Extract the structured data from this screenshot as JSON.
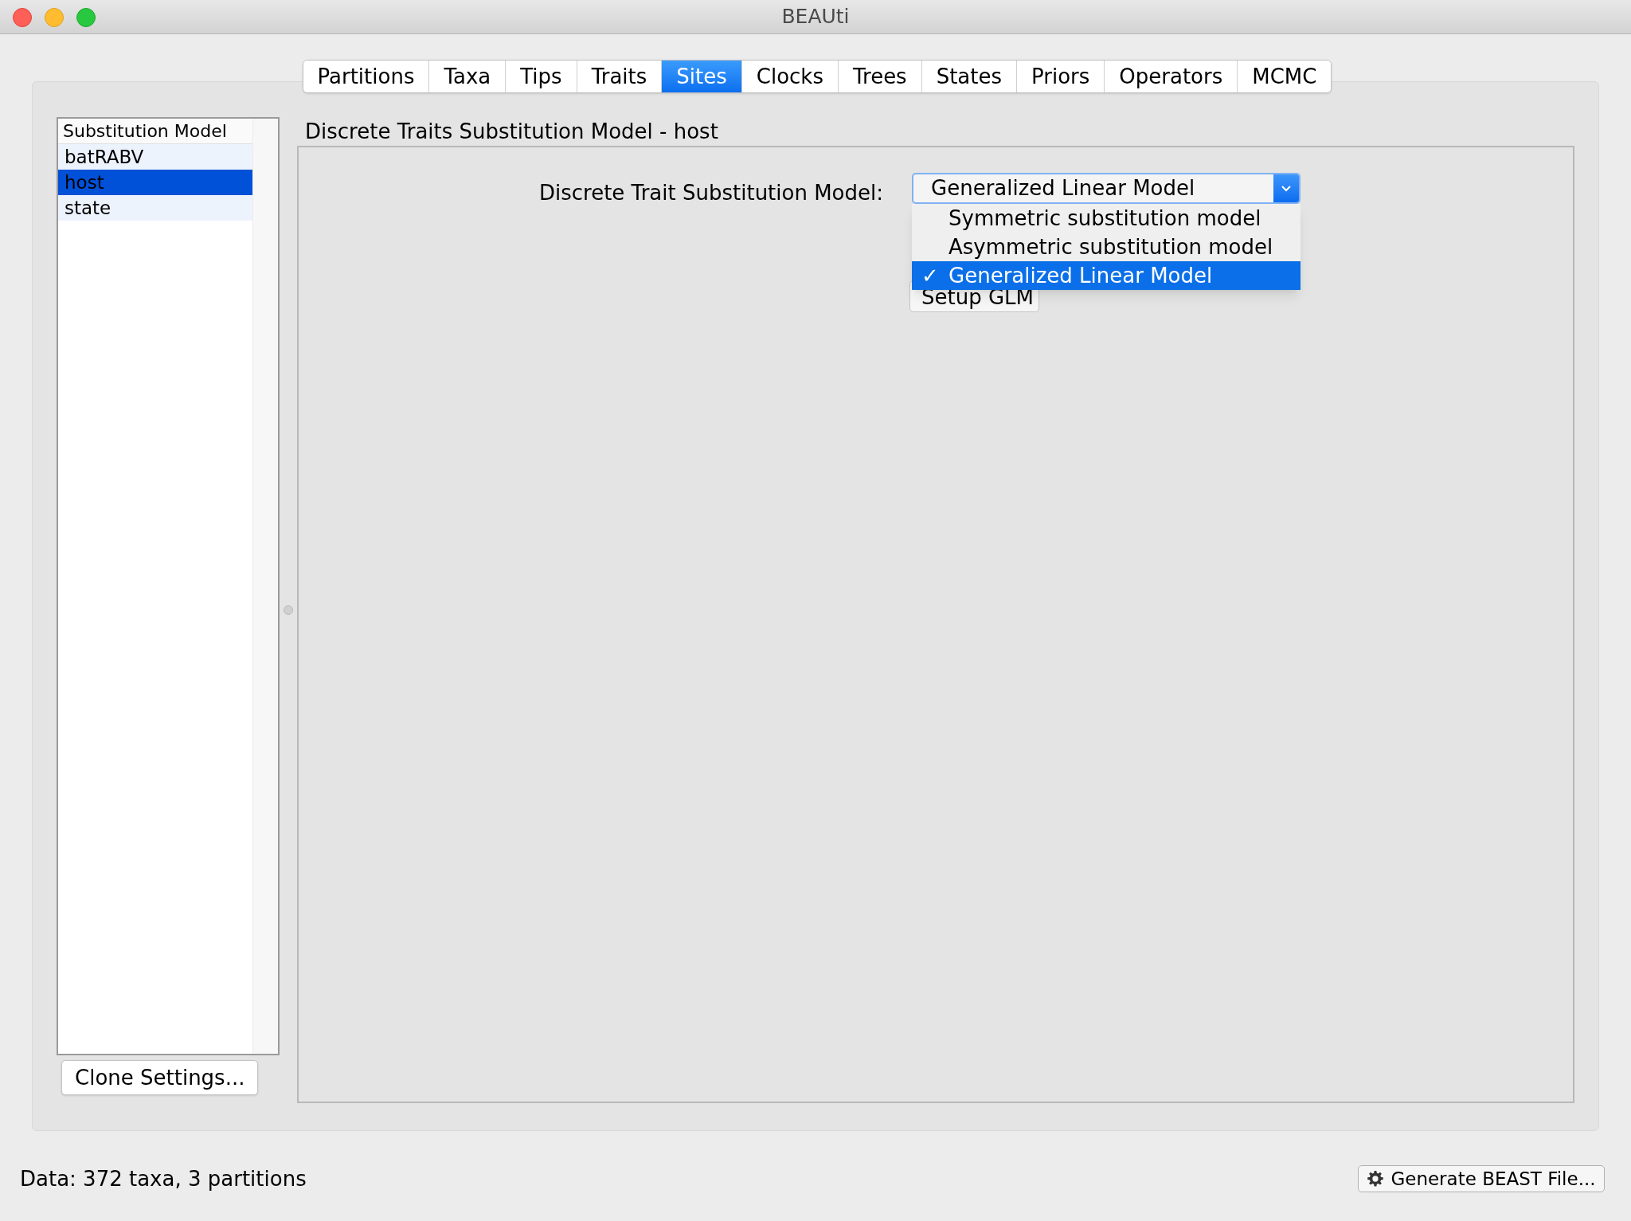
{
  "window": {
    "title": "BEAUti"
  },
  "tabs": [
    {
      "label": "Partitions",
      "selected": false
    },
    {
      "label": "Taxa",
      "selected": false
    },
    {
      "label": "Tips",
      "selected": false
    },
    {
      "label": "Traits",
      "selected": false
    },
    {
      "label": "Sites",
      "selected": true
    },
    {
      "label": "Clocks",
      "selected": false
    },
    {
      "label": "Trees",
      "selected": false
    },
    {
      "label": "States",
      "selected": false
    },
    {
      "label": "Priors",
      "selected": false
    },
    {
      "label": "Operators",
      "selected": false
    },
    {
      "label": "MCMC",
      "selected": false
    }
  ],
  "substitution_list": {
    "header": "Substitution Model",
    "items": [
      {
        "label": "batRABV",
        "selected": false
      },
      {
        "label": "host",
        "selected": true
      },
      {
        "label": "state",
        "selected": false
      }
    ]
  },
  "clone_button": "Clone Settings...",
  "panel_title": "Discrete Traits Substitution Model - host",
  "model_field": {
    "label": "Discrete Trait Substitution Model:",
    "value": "Generalized Linear Model"
  },
  "dropdown_menu": {
    "check_mark": "✓",
    "items": [
      {
        "label": "Symmetric substitution model",
        "selected": false
      },
      {
        "label": "Asymmetric substitution model",
        "selected": false
      },
      {
        "label": "Generalized Linear Model",
        "selected": true
      }
    ]
  },
  "setup_button": "Setup GLM",
  "status_bar": {
    "text": "Data: 372 taxa, 3 partitions",
    "generate_button": "Generate BEAST File..."
  }
}
